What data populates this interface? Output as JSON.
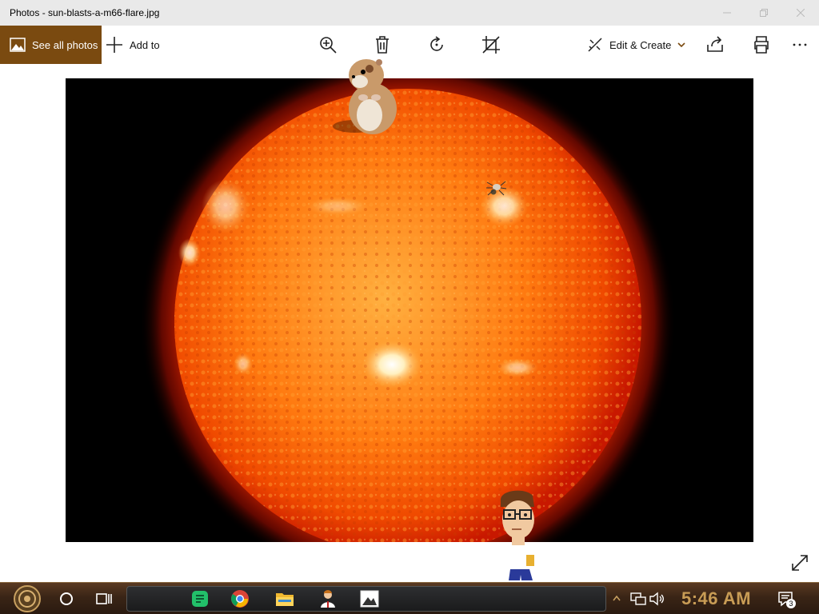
{
  "window": {
    "title": "Photos - sun-blasts-a-m66-flare.jpg"
  },
  "toolbar": {
    "see_all_label": "See all photos",
    "add_to_label": "Add to",
    "edit_create_label": "Edit & Create",
    "icons": [
      "zoom-in-icon",
      "delete-icon",
      "rotate-icon",
      "crop-icon",
      "share-icon",
      "print-icon",
      "more-icon"
    ]
  },
  "colors": {
    "accent": "#7a4a10",
    "titlebar": "#e9e9e9",
    "sun_core": "#ff7a10",
    "sun_edge": "#c81800",
    "clock": "#c89c55"
  },
  "taskbar": {
    "clock": "5:46 AM",
    "notification_count": "3",
    "pinned_apps": [
      "spotify-green-app",
      "chrome-app",
      "file-explorer-app",
      "people-app",
      "photos-app"
    ]
  }
}
